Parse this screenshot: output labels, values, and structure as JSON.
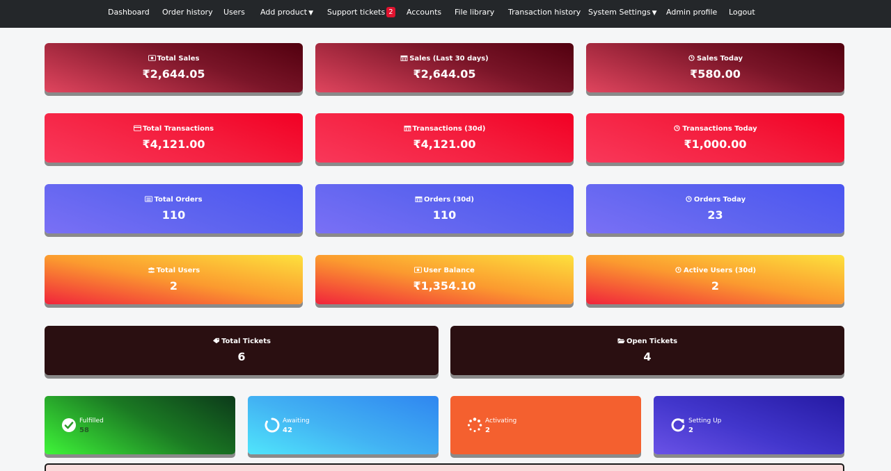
{
  "nav": {
    "dashboard": "Dashboard",
    "order_history": "Order history",
    "users": "Users",
    "add_product": "Add product",
    "support_tickets": "Support tickets",
    "support_badge": "2",
    "accounts": "Accounts",
    "file_library": "File library",
    "transaction_history": "Transaction history",
    "system_settings": "System Settings",
    "admin_profile": "Admin profile",
    "logout": "Logout",
    "caret": "▼"
  },
  "stats": {
    "total_sales": {
      "label": "Total Sales",
      "value": "₹2,644.05",
      "icon": "money-icon"
    },
    "sales_30d": {
      "label": "Sales (Last 30 days)",
      "value": "₹2,644.05",
      "icon": "calendar-icon"
    },
    "sales_today": {
      "label": "Sales Today",
      "value": "₹580.00",
      "icon": "clock-icon"
    },
    "total_transactions": {
      "label": "Total Transactions",
      "value": "₹4,121.00",
      "icon": "credit-card-icon"
    },
    "transactions_30d": {
      "label": "Transactions (30d)",
      "value": "₹4,121.00",
      "icon": "calendar-icon"
    },
    "transactions_today": {
      "label": "Transactions Today",
      "value": "₹1,000.00",
      "icon": "clock-icon"
    },
    "total_orders": {
      "label": "Total Orders",
      "value": "110",
      "icon": "list-icon"
    },
    "orders_30d": {
      "label": "Orders (30d)",
      "value": "110",
      "icon": "calendar-icon"
    },
    "orders_today": {
      "label": "Orders Today",
      "value": "23",
      "icon": "clock-icon"
    },
    "total_users": {
      "label": "Total Users",
      "value": "2",
      "icon": "users-icon"
    },
    "user_balance": {
      "label": "User Balance",
      "value": "₹1,354.10",
      "icon": "money-icon"
    },
    "active_users": {
      "label": "Active Users (30d)",
      "value": "2",
      "icon": "clock-icon"
    },
    "total_tickets": {
      "label": "Total Tickets",
      "value": "6",
      "icon": "ticket-icon"
    },
    "open_tickets": {
      "label": "Open Tickets",
      "value": "4",
      "icon": "folder-open-icon"
    }
  },
  "status": {
    "fulfilled": {
      "label": "Fulfilled",
      "count": "58",
      "icon": "check-circle-icon"
    },
    "awaiting": {
      "label": "Awaiting",
      "count": "42",
      "icon": "circle-notch-icon"
    },
    "activating": {
      "label": "Activating",
      "count": "2",
      "icon": "spinner-icon"
    },
    "setting_up": {
      "label": "Setting Up",
      "count": "2",
      "icon": "redo-icon"
    }
  },
  "colors": {
    "navbar": "#24272a",
    "badge": "#e0132f",
    "sales": "#7a1528",
    "transactions": "#f20024",
    "orders": "#5e64ef",
    "users": "#fb9a2f",
    "tickets": "#2a0f11",
    "fulfilled": "#1b7a23",
    "awaiting": "#42b2f3",
    "activating": "#f4602f",
    "setting_up": "#4236cc"
  }
}
